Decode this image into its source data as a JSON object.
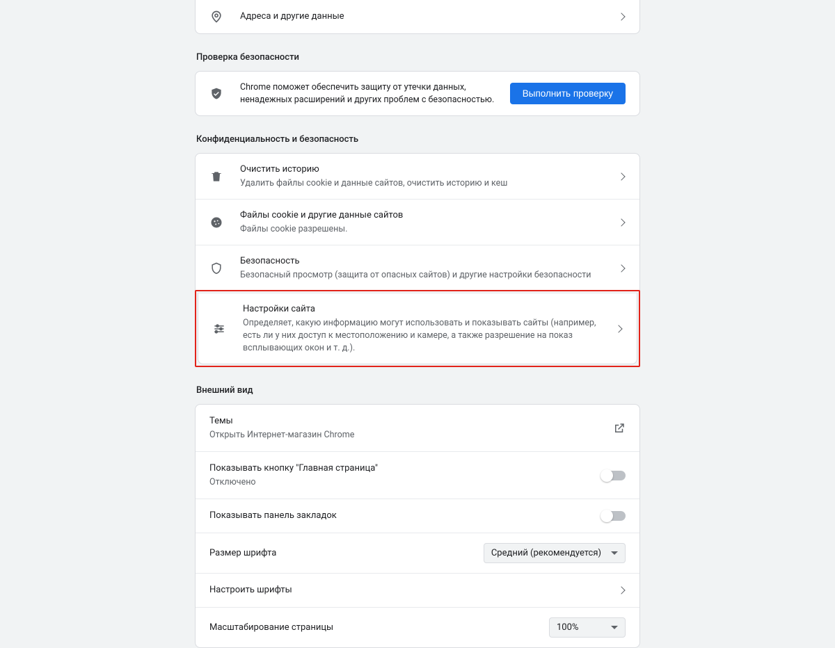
{
  "autofill": {
    "addresses_label": "Адреса и другие данные"
  },
  "safety": {
    "section_title": "Проверка безопасности",
    "desc": "Chrome поможет обеспечить защиту от утечки данных, ненадежных расширений и других проблем с безопасностью.",
    "button": "Выполнить проверку"
  },
  "privacy": {
    "section_title": "Конфиденциальность и безопасность",
    "clear_title": "Очистить историю",
    "clear_sub": "Удалить файлы cookie и данные сайтов, очистить историю и кеш",
    "cookies_title": "Файлы cookie и другие данные сайтов",
    "cookies_sub": "Файлы cookie разрешены.",
    "security_title": "Безопасность",
    "security_sub": "Безопасный просмотр (защита от опасных сайтов) и другие настройки безопасности",
    "site_title": "Настройки сайта",
    "site_sub": "Определяет, какую информацию могут использовать и показывать сайты (например, есть ли у них доступ к местоположению и камере, а также разрешение на показ всплывающих окон и т. д.)."
  },
  "appearance": {
    "section_title": "Внешний вид",
    "themes_title": "Темы",
    "themes_sub": "Открыть Интернет-магазин Chrome",
    "home_title": "Показывать кнопку \"Главная страница\"",
    "home_sub": "Отключено",
    "bookmarks_title": "Показывать панель закладок",
    "fontsize_title": "Размер шрифта",
    "fontsize_value": "Средний (рекомендуется)",
    "customfonts_title": "Настроить шрифты",
    "zoom_title": "Масштабирование страницы",
    "zoom_value": "100%"
  }
}
